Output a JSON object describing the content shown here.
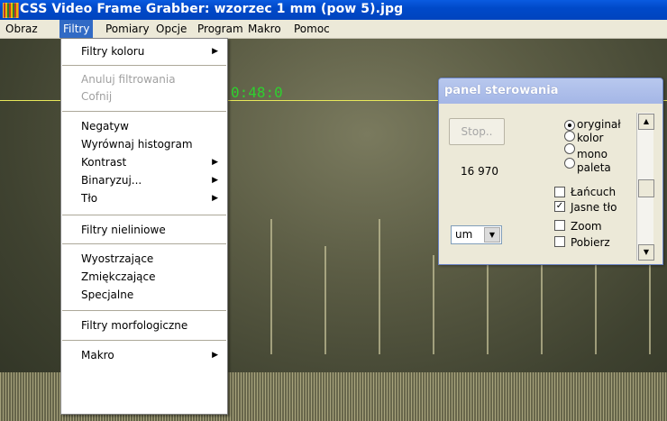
{
  "window": {
    "title": "CSS Video Frame Grabber: wzorzec 1 mm (pow 5).jpg"
  },
  "menubar": [
    "Obraz",
    "Filtry",
    "Pomiary",
    "Opcje",
    "Program",
    "Makro",
    "Pomoc"
  ],
  "overlay": {
    "timecode": "0:48:0"
  },
  "filtry_menu": {
    "filtry_koloru": "Filtry koloru",
    "anuluj": "Anuluj filtrowania",
    "cofnij": "Cofnij",
    "negatyw": "Negatyw",
    "wyrownaj": "Wyrównaj histogram",
    "kontrast": "Kontrast",
    "binaryzuj": "Binaryzuj...",
    "tlo": "Tło",
    "nieliniowe": "Filtry nieliniowe",
    "wyostrzajace": "Wyostrzające",
    "zmiekczajace": "Zmiękczające",
    "specjalne": "Specjalne",
    "morfologiczne": "Filtry morfologiczne",
    "makro": "Makro"
  },
  "panel": {
    "title": "panel sterowania",
    "stop_label": "Stop..",
    "counter": "16 970",
    "unit": "um",
    "radio_oryginal": "oryginał",
    "radio_kolor": "kolor",
    "radio_mono": "mono",
    "radio_paleta": "paleta",
    "check_lancuch": "Łańcuch",
    "check_jasne": "Jasne tło",
    "check_zoom": "Zoom",
    "check_pobierz": "Pobierz"
  },
  "colors": {
    "titlebar": "#0050d8",
    "menu_highlight": "#316ac5",
    "panel_title": "#b0c0ea"
  }
}
